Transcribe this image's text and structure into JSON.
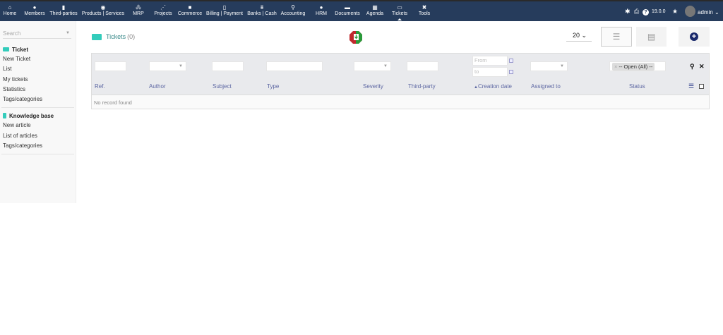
{
  "topbar": {
    "menu": [
      {
        "label": "Home",
        "icon": "home-icon",
        "glyph": "⌂"
      },
      {
        "label": "Members",
        "icon": "user-icon",
        "glyph": "●"
      },
      {
        "label": "Third-parties",
        "icon": "building-icon",
        "glyph": "▮"
      },
      {
        "label": "Products | Services",
        "icon": "cube-icon",
        "glyph": "◉"
      },
      {
        "label": "MRP",
        "icon": "cubes-icon",
        "glyph": "⁂"
      },
      {
        "label": "Projects",
        "icon": "sitemap-icon",
        "glyph": "⋰"
      },
      {
        "label": "Commerce",
        "icon": "suitcase-icon",
        "glyph": "■"
      },
      {
        "label": "Billing | Payment",
        "icon": "invoice-icon",
        "glyph": "▯"
      },
      {
        "label": "Banks | Cash",
        "icon": "bank-icon",
        "glyph": "⩩"
      },
      {
        "label": "Accounting",
        "icon": "search-dollar-icon",
        "glyph": "⚲"
      },
      {
        "label": "HRM",
        "icon": "user-tie-icon",
        "glyph": "●"
      },
      {
        "label": "Documents",
        "icon": "folder-icon",
        "glyph": "▬"
      },
      {
        "label": "Agenda",
        "icon": "calendar-icon",
        "glyph": "▦"
      },
      {
        "label": "Tickets",
        "icon": "ticket-icon",
        "glyph": "▭"
      },
      {
        "label": "Tools",
        "icon": "tools-icon",
        "glyph": "✖"
      }
    ],
    "version": "19.0.0",
    "user": "admin"
  },
  "sidebar": {
    "search_placeholder": "Search",
    "sections": [
      {
        "title": "Ticket",
        "items": [
          "New Ticket",
          "List",
          "My tickets",
          "Statistics",
          "Tags/categories"
        ]
      },
      {
        "title": "Knowledge base",
        "items": [
          "New article",
          "List of articles",
          "Tags/categories"
        ]
      }
    ]
  },
  "main": {
    "title": "Tickets",
    "count": "(0)",
    "per_page": "20",
    "filters": {
      "date_from_placeholder": "From",
      "date_to_placeholder": "to",
      "status_value": "-- Open (All) --"
    },
    "columns": [
      "Ref.",
      "Author",
      "Subject",
      "Type",
      "Severity",
      "Third-party",
      "Creation date",
      "Assigned to",
      "Status"
    ],
    "empty_message": "No record found"
  }
}
